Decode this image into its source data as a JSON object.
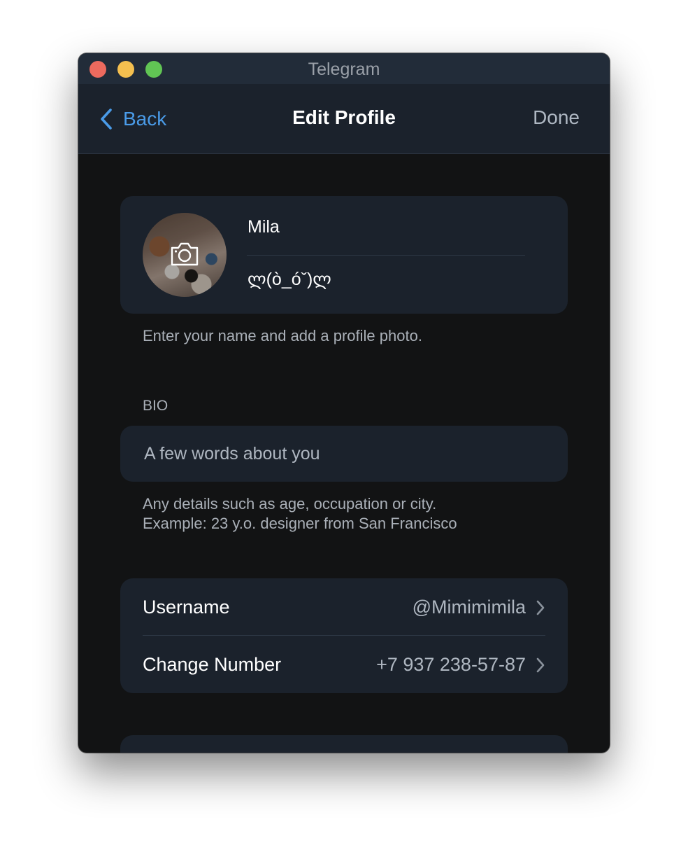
{
  "window": {
    "title": "Telegram"
  },
  "navbar": {
    "back_label": "Back",
    "title": "Edit Profile",
    "done_label": "Done"
  },
  "profile": {
    "first_name": "Mila",
    "last_name": "ლ(ò_óˇ)ლ",
    "hint": "Enter your name and add a profile photo."
  },
  "bio": {
    "section_label": "BIO",
    "placeholder": "A few words about you",
    "hint_line1": "Any details such as age, occupation or city.",
    "hint_line2": "Example: 23 y.o. designer from San Francisco"
  },
  "account": {
    "rows": [
      {
        "label": "Username",
        "value": "@Mimimimila"
      },
      {
        "label": "Change Number",
        "value": "+7 937 238-57-87"
      }
    ]
  },
  "icons": {
    "back": "chevron-left-icon",
    "avatar_overlay": "camera-icon",
    "row_disclosure": "chevron-right-icon"
  },
  "colors": {
    "accent": "#4a9be8",
    "background": "#121314",
    "card": "#1b222c",
    "titlebar": "#222c39",
    "close": "#ed6a5e",
    "minimize": "#f4bf4f",
    "maximize": "#61c554"
  }
}
